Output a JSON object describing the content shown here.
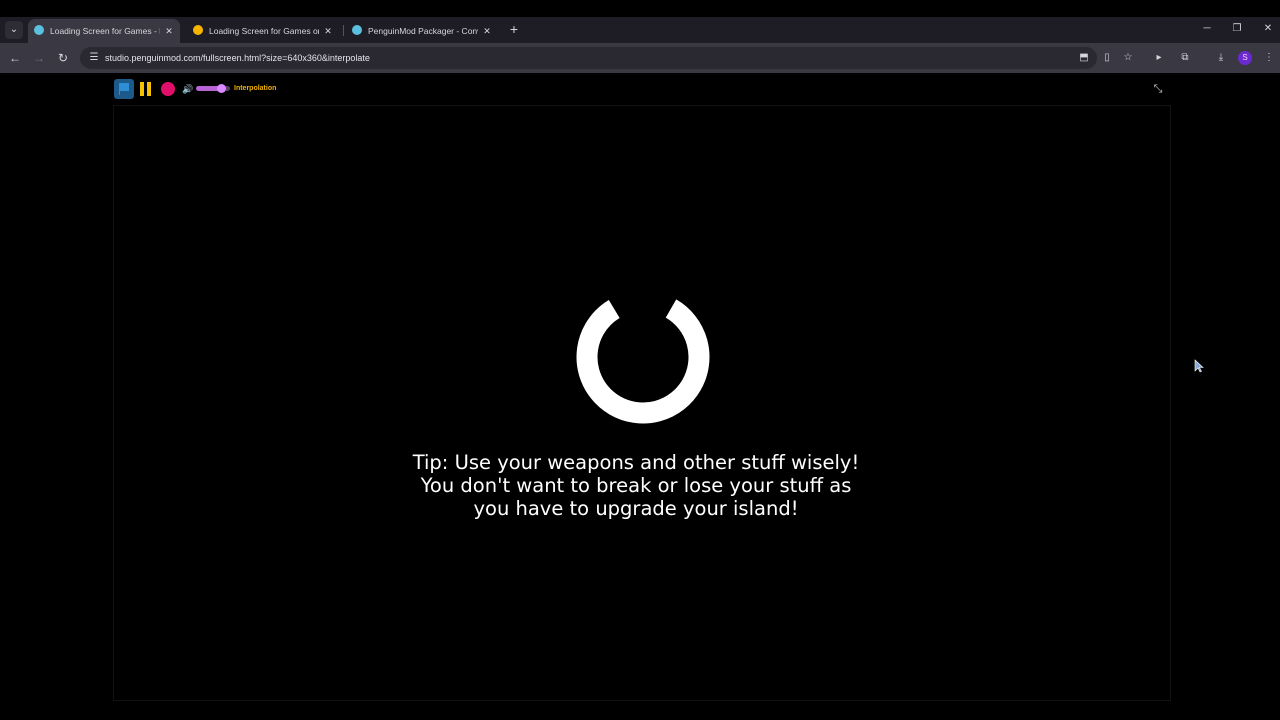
{
  "tabs": [
    {
      "title": "Loading Screen for Games - Pe",
      "favicon": "penguinmod-icon",
      "active": true,
      "favicon_color": "#5bc0de"
    },
    {
      "title": "Loading Screen for Games on S",
      "favicon": "scratch-icon",
      "active": false,
      "favicon_color": "#f7b500"
    },
    {
      "title": "PenguinMod Packager - Conve",
      "favicon": "penguinmod-icon",
      "active": false,
      "favicon_color": "#5bc0de"
    }
  ],
  "tab_close_glyph": "✕",
  "new_tab_glyph": "+",
  "window_controls": {
    "minimize": "─",
    "restore": "❐",
    "close": "✕"
  },
  "address_bar": {
    "url": "studio.penguinmod.com/fullscreen.html?size=640x360&interpolate"
  },
  "profile_initial": "S",
  "player": {
    "interpolation_label": "Interpolation",
    "volume_level": 0.75
  },
  "stage": {
    "tip_lines": [
      "Tip: Use your weapons and other stuff wisely!",
      "You don't want to break or lose your stuff as",
      "you have to upgrade your island!"
    ],
    "loading_progress": 0.83
  },
  "colors": {
    "pause": "#f5c200",
    "stop": "#e0106a",
    "volume": "#b964d6",
    "interpolation": "#f0b100"
  }
}
